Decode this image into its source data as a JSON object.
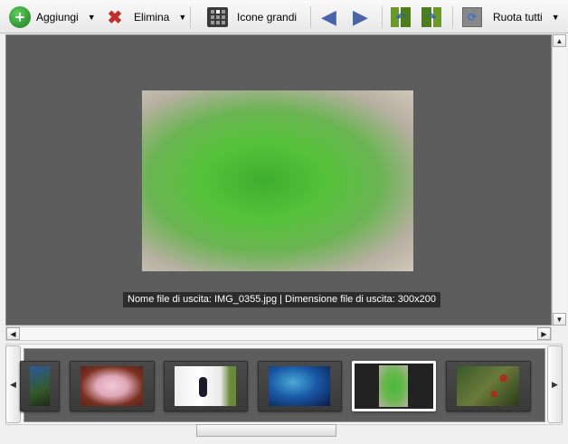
{
  "toolbar": {
    "add": "Aggiungi",
    "delete": "Elimina",
    "large_icons": "Icone grandi",
    "rotate_all": "Ruota tutti"
  },
  "preview": {
    "caption": "Nome file di uscita: IMG_0355.jpg | Dimensione file di uscita: 300x200"
  },
  "thumbnails": [
    {
      "name": "palms"
    },
    {
      "name": "flowers"
    },
    {
      "name": "bird"
    },
    {
      "name": "blue"
    },
    {
      "name": "grass",
      "selected": true
    },
    {
      "name": "berries"
    }
  ],
  "colors": {
    "preview_bg": "#5d5d5d",
    "accent_green": "#2e9a2e"
  }
}
